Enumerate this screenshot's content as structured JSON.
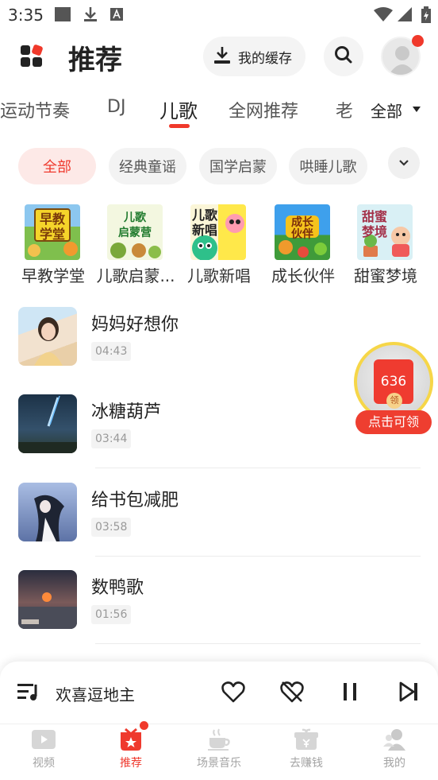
{
  "status_bar": {
    "time": "3:35",
    "icons": [
      "notification-square-icon",
      "download-icon",
      "a-icon",
      "wifi-icon",
      "signal-icon",
      "battery-icon"
    ]
  },
  "header": {
    "title": "推荐",
    "cache_label": "我的缓存",
    "icons": [
      "app-grid-icon",
      "download-icon",
      "search-icon",
      "avatar-icon"
    ]
  },
  "tabs": {
    "items": [
      "运动节奏",
      "DJ",
      "儿歌",
      "全网推荐",
      "老"
    ],
    "active": "儿歌",
    "all_label": "全部"
  },
  "chips": {
    "items": [
      "全部",
      "经典童谣",
      "国学启蒙",
      "哄睡儿歌"
    ],
    "active": "全部"
  },
  "categories": [
    {
      "label": "早教学堂",
      "cover_text": "早教\n学堂"
    },
    {
      "label": "儿歌启蒙...",
      "cover_text": "儿歌\n启蒙营"
    },
    {
      "label": "儿歌新唱",
      "cover_text": "儿歌\n新唱"
    },
    {
      "label": "成长伙伴",
      "cover_text": "成长\n伙伴"
    },
    {
      "label": "甜蜜梦境",
      "cover_text": "甜蜜\n梦境"
    }
  ],
  "songs": [
    {
      "title": "妈妈好想你",
      "duration": "04:43"
    },
    {
      "title": "冰糖葫芦",
      "duration": "03:44"
    },
    {
      "title": "给书包减肥",
      "duration": "03:58"
    },
    {
      "title": "数鸭歌",
      "duration": "01:56"
    }
  ],
  "reward": {
    "amount": "636",
    "coin_label": "领",
    "cta": "点击可领"
  },
  "player": {
    "now_playing": "欢喜逗地主",
    "icons": [
      "playlist-icon",
      "heart-icon",
      "dislike-heart-icon",
      "pause-icon",
      "next-icon"
    ]
  },
  "bottom_nav": {
    "items": [
      "视频",
      "推荐",
      "场景音乐",
      "去赚钱",
      "我的"
    ],
    "active": "推荐"
  },
  "colors": {
    "accent": "#ef3a2e",
    "chip_active_bg": "#fde9e7",
    "reward_ring": "#f6d648"
  }
}
